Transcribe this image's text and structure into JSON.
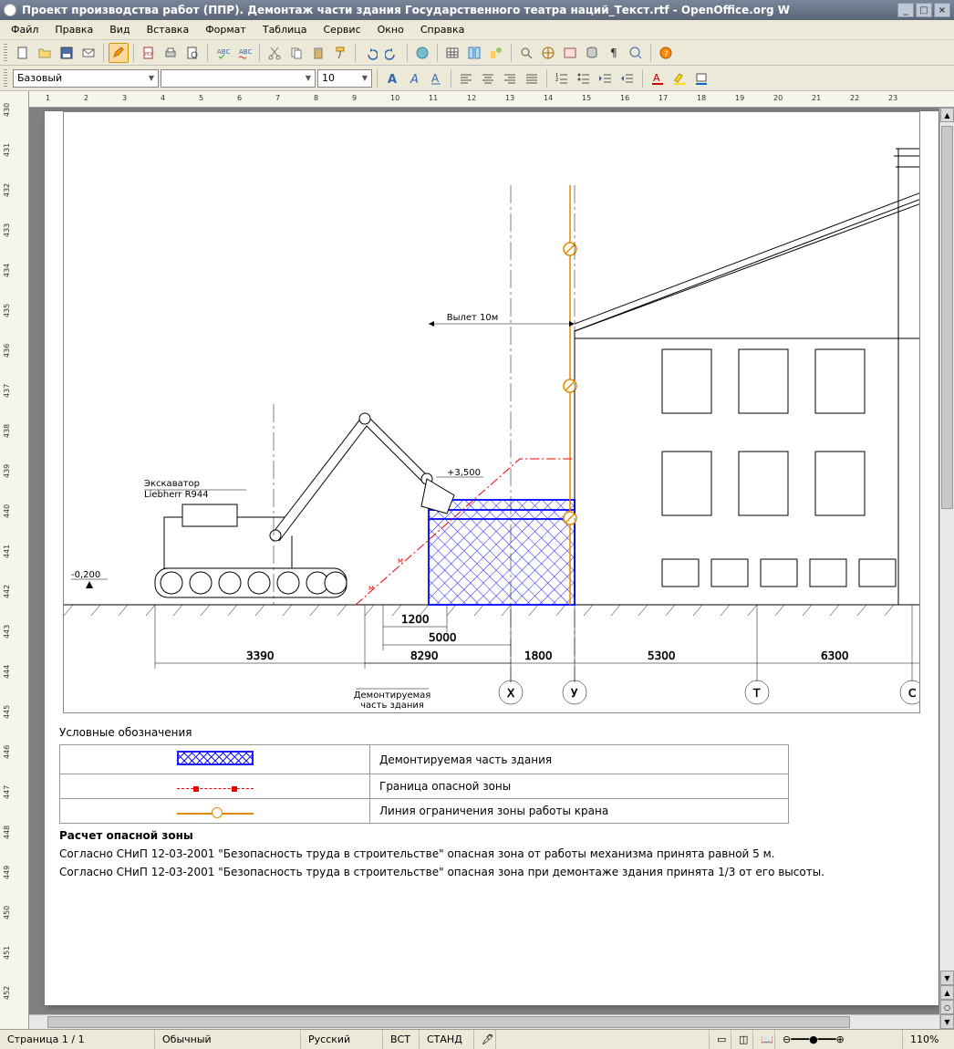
{
  "titlebar": {
    "title": "Проект производства работ (ППР). Демонтаж части здания Государственного театра наций_Текст.rtf - OpenOffice.org W"
  },
  "menus": [
    "Файл",
    "Правка",
    "Вид",
    "Вставка",
    "Формат",
    "Таблица",
    "Сервис",
    "Окно",
    "Справка"
  ],
  "format_toolbar": {
    "style": "Базовый",
    "font_name": "",
    "font_size": "10"
  },
  "ruler_h": [
    "1",
    "2",
    "3",
    "4",
    "5",
    "6",
    "7",
    "8",
    "9",
    "10",
    "11",
    "12",
    "13",
    "14",
    "15",
    "16",
    "17",
    "18",
    "19",
    "20",
    "21",
    "22",
    "23"
  ],
  "ruler_v": [
    "430",
    "431",
    "432",
    "433",
    "434",
    "435",
    "436",
    "437",
    "438",
    "439",
    "440",
    "441",
    "442",
    "443",
    "444",
    "445",
    "446",
    "447",
    "448",
    "449",
    "450",
    "451",
    "452"
  ],
  "drawing": {
    "excavator_label": "Экскаватор\nLiebherr R944",
    "reach_label": "Вылет 10м",
    "height_label": "+3,500",
    "ground_level": "-0,200",
    "demolish_label": "Демонтируемая\nчасть здания",
    "dims": {
      "d1": "3390",
      "d2": "8290",
      "d3": "5000",
      "d4": "1200",
      "d5": "1800",
      "d6": "5300",
      "d7": "6300"
    },
    "axes": [
      "Х",
      "У",
      "Т",
      "С"
    ]
  },
  "legend": {
    "heading": "Условные обозначения",
    "rows": [
      {
        "symbol": "hatch",
        "text": "Демонтируемая часть здания"
      },
      {
        "symbol": "red",
        "text": "Граница опасной зоны"
      },
      {
        "symbol": "orange",
        "text": "Линия ограничения зоны работы крана"
      }
    ]
  },
  "calc": {
    "heading": "Расчет опасной зоны",
    "p1": "Согласно СНиП 12-03-2001 \"Безопасность труда в строительстве\" опасная зона от работы механизма принята равной 5 м.",
    "p2": "Согласно СНиП 12-03-2001 \"Безопасность труда в строительстве\" опасная зона при демонтаже здания принята 1/3 от его высоты."
  },
  "statusbar": {
    "page": "Страница  1 / 1",
    "style": "Обычный",
    "lang": "Русский",
    "ins": "ВСТ",
    "std": "СТАНД",
    "zoom": "110%"
  }
}
